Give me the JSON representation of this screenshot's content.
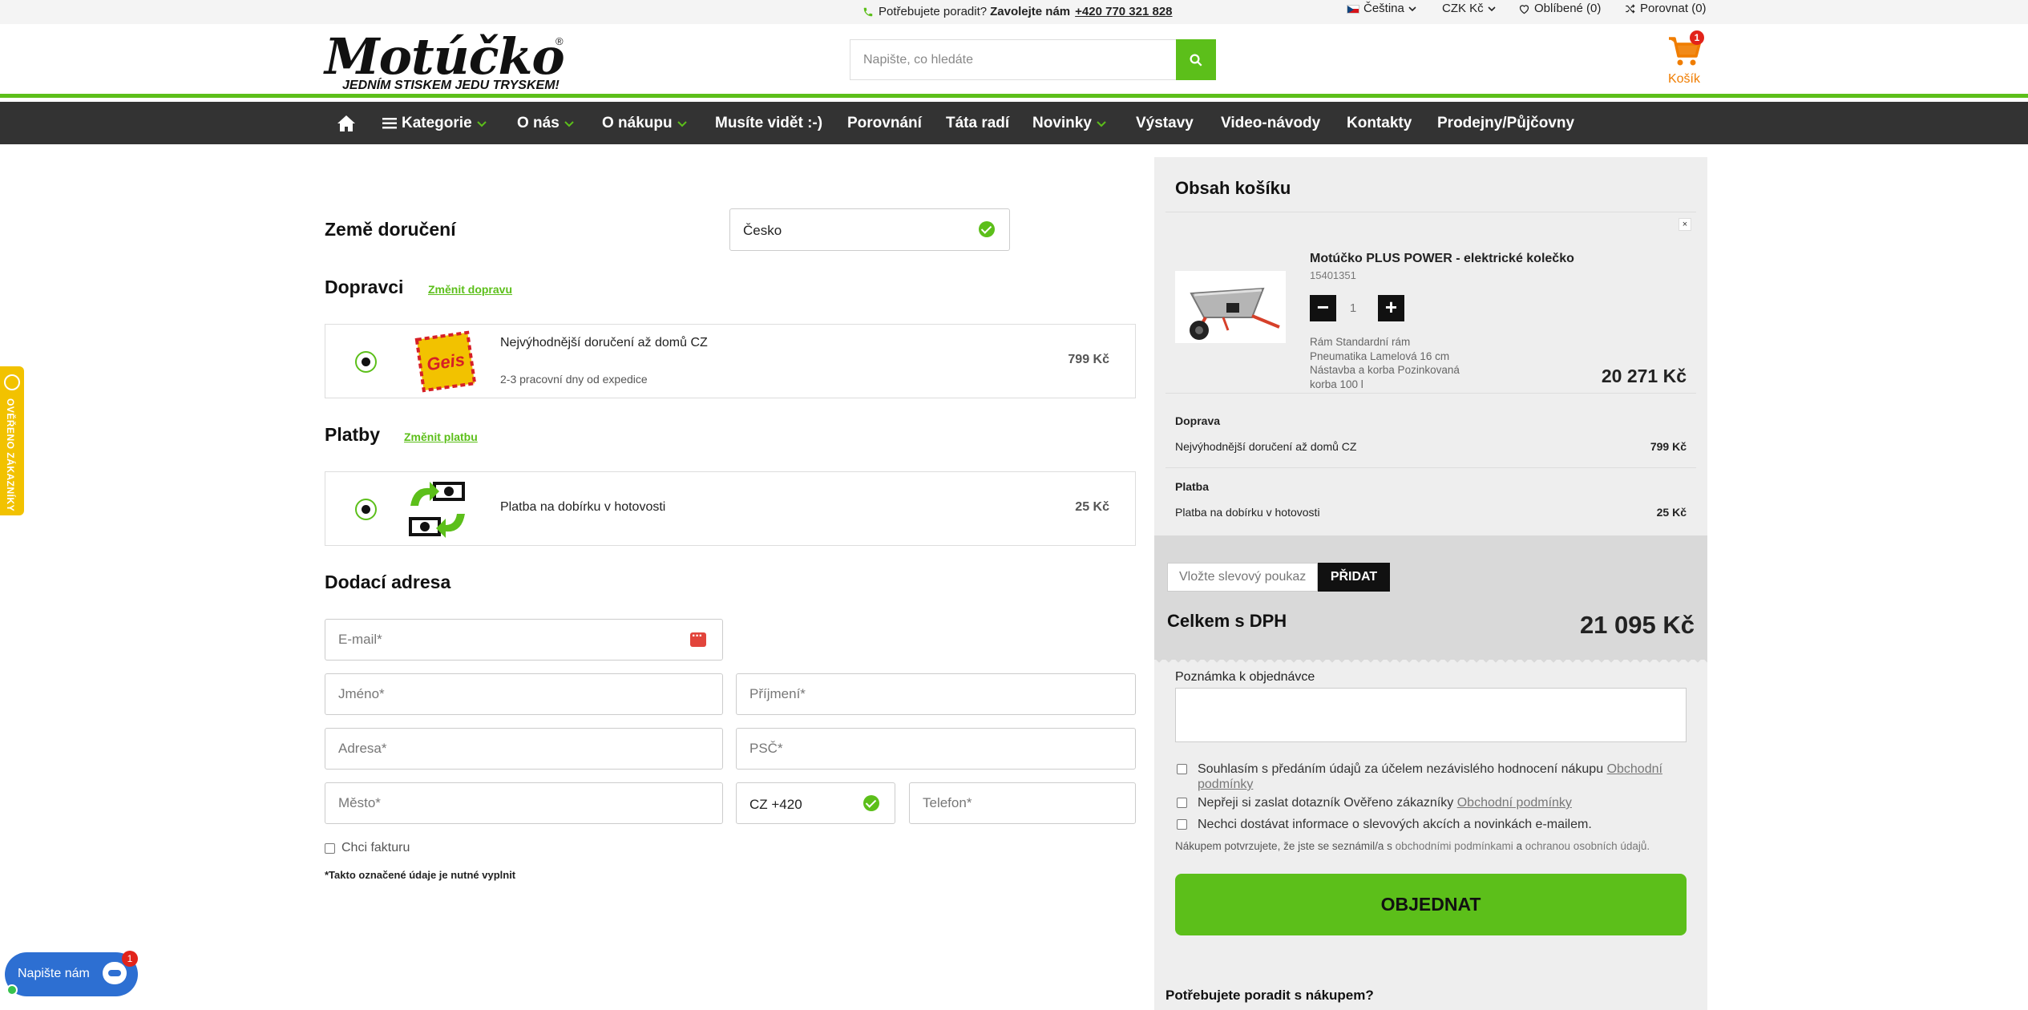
{
  "topbar": {
    "help_prefix": "Potřebujete poradit?",
    "help_call": "Zavolejte nám",
    "help_phone": "+420 770 321 828",
    "language": "Čeština",
    "currency": "CZK Kč",
    "favorites": "Oblíbené (0)",
    "compare": "Porovnat (0)"
  },
  "header": {
    "logo_text": "Motúčko",
    "logo_slogan": "JEDNÍM STISKEM JEDU TRYSKEM!",
    "search_placeholder": "Napište, co hledáte",
    "cart_label": "Košík",
    "cart_count": "1"
  },
  "nav": {
    "items": [
      "Kategorie",
      "O nás",
      "O nákupu",
      "Musíte vidět :-)",
      "Porovnání",
      "Táta radí",
      "Novinky",
      "Výstavy",
      "Video-návody",
      "Kontakty",
      "Prodejny/Půjčovny"
    ]
  },
  "checkout": {
    "country_label": "Země doručení",
    "country_value": "Česko",
    "carriers_title": "Dopravci",
    "carriers_change": "Změnit dopravu",
    "carrier": {
      "name": "Nejvýhodnější doručení až domů CZ",
      "sub": "2-3 pracovní dny od expedice",
      "price": "799 Kč",
      "logo_text": "Geis"
    },
    "payments_title": "Platby",
    "payments_change": "Změnit platbu",
    "payment": {
      "name": "Platba na dobírku v hotovosti",
      "price": "25 Kč"
    },
    "address_title": "Dodací adresa",
    "fields": {
      "email": "E-mail*",
      "first_name": "Jméno*",
      "last_name": "Příjmení*",
      "address": "Adresa*",
      "zip": "PSČ*",
      "city": "Město*",
      "phone_prefix": "CZ +420",
      "phone": "Telefon*"
    },
    "invoice_label": "Chci fakturu",
    "required_note": "*Takto označené údaje je nutné vyplnit"
  },
  "cart": {
    "title": "Obsah košíku",
    "close": "×",
    "product": {
      "name": "Motúčko PLUS POWER - elektrické kolečko",
      "code": "15401351",
      "qty": "1",
      "minus": "−",
      "plus": "+",
      "attrs": [
        "Rám Standardní rám",
        "Pneumatika Lamelová 16 cm",
        "Nástavba a korba Pozinkovaná korba 100 l"
      ],
      "price": "20 271 Kč"
    },
    "shipping_head": "Doprava",
    "shipping_line": "Nejvýhodnější doručení až domů CZ",
    "shipping_price": "799 Kč",
    "payment_head": "Platba",
    "payment_line": "Platba na dobírku v hotovosti",
    "payment_price": "25 Kč",
    "voucher_placeholder": "Vložte slevový poukaz",
    "voucher_button": "PŘIDAT",
    "total_label": "Celkem s DPH",
    "total_value": "21 095 Kč",
    "note_label": "Poznámka k objednávce",
    "consent1_text": "Souhlasím s předáním údajů za účelem nezávislého hodnocení nákupu",
    "consent1_link": "Obchodní podmínky",
    "consent2_text": "Nepřeji si zaslat dotazník Ověřeno zákazníky",
    "consent2_link": "Obchodní podmínky",
    "consent3_text": "Nechci dostávat informace o slevových akcích a novinkách e-mailem.",
    "confirm_pre": "Nákupem potvrzujete, že jste se seznámil/a s",
    "confirm_link1": "obchodními podmínkami",
    "confirm_mid": "a",
    "confirm_link2": "ochranou osobních údajů.",
    "order_button": "OBJEDNAT",
    "help_title": "Potřebujete poradit s nákupem?"
  },
  "widgets": {
    "verified_label": "OVĚŘENO ZÁKAZNÍKY",
    "chat_label": "Napište nám",
    "chat_badge": "1"
  },
  "colors": {
    "accent_green": "#5cbf1a",
    "cart_orange": "#f07d00",
    "nav_dark": "#333333"
  }
}
